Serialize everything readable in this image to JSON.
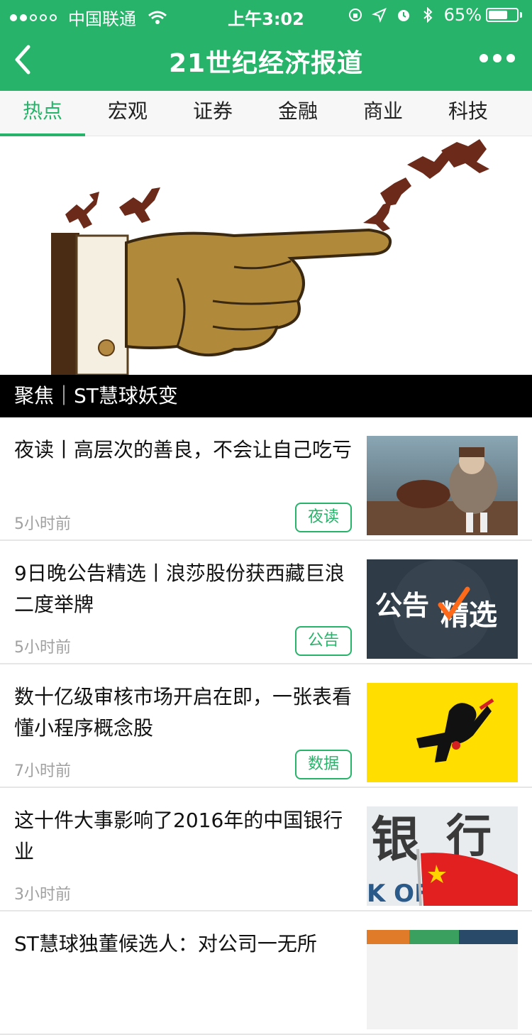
{
  "status_bar": {
    "carrier": "中国联通",
    "time": "上午3:02",
    "battery_percent": "65%"
  },
  "nav": {
    "title": "21世纪经济报道"
  },
  "tabs": [
    {
      "label": "热点"
    },
    {
      "label": "宏观"
    },
    {
      "label": "证券"
    },
    {
      "label": "金融"
    },
    {
      "label": "商业"
    },
    {
      "label": "科技"
    }
  ],
  "hero": {
    "caption": "聚焦｜ST慧球妖变"
  },
  "news": [
    {
      "title": "夜读丨高层次的善良，不会让自己吃亏",
      "time": "5小时前",
      "tag": "夜读"
    },
    {
      "title": "9日晚公告精选丨浪莎股份获西藏巨浪二度举牌",
      "time": "5小时前",
      "tag": "公告"
    },
    {
      "title": "数十亿级审核市场开启在即，一张表看懂小程序概念股",
      "time": "7小时前",
      "tag": "数据"
    },
    {
      "title": "这十件大事影响了2016年的中国银行业",
      "time": "3小时前",
      "tag": ""
    },
    {
      "title": "ST慧球独董候选人：对公司一无所",
      "time": "",
      "tag": ""
    }
  ],
  "thumbs": {
    "notice_text_1": "公告",
    "notice_text_2": "精选",
    "bank_text_1": "银",
    "bank_text_2": "行",
    "bank_text_3": "K OF"
  },
  "colors": {
    "brand_green": "#27b36a"
  }
}
